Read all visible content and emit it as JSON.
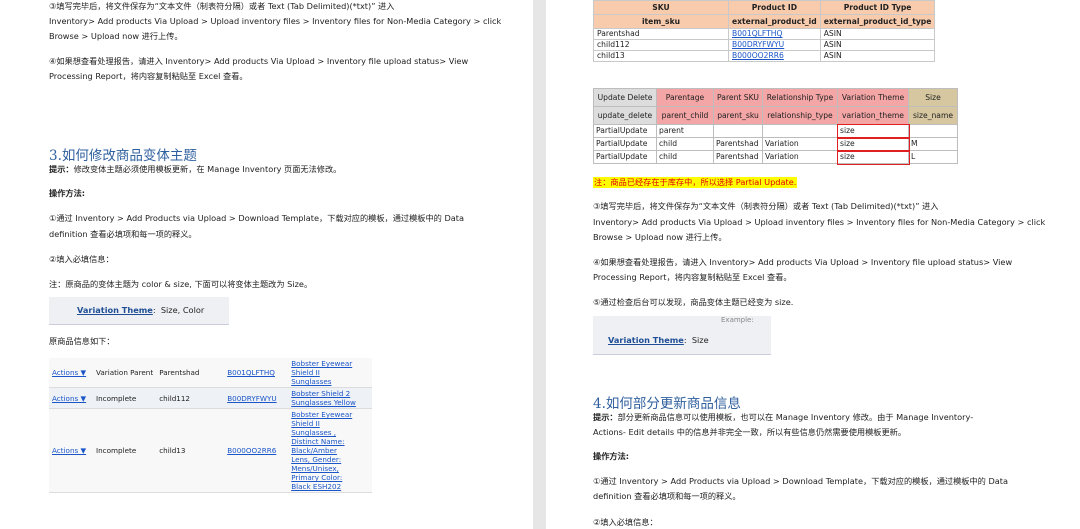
{
  "left": {
    "p3a": "③填写完毕后，将文件保存为“文本文件（制表符分隔）或者 Text (Tab Delimited)(*txt)” 进入",
    "p3b": "Inventory> Add products Via Upload > Upload inventory files > Inventory files for Non-Media Category > click",
    "p3c": "Browse > Upload now 进行上传。",
    "p4a": "④如果想查看处理报告，请进入 Inventory> Add products Via Upload > Inventory file upload status> View",
    "p4b": "Processing Report，将内容复制粘贴至 Excel 查看。",
    "heading": "3.如何修改商品变体主题",
    "tip_label": "提示：",
    "tip": "修改变体主题必须使用模板更新，在 Manage Inventory 页面无法修改。",
    "method": "操作方法:",
    "s1a": "①通过 Inventory > Add Products via Upload > Download Template，下载对应的模板，通过模板中的 Data",
    "s1b": "definition 查看必填项和每一项的释义。",
    "s2": "②填入必填信息：",
    "note": "注：原商品的变体主题为 color & size, 下面可以将变体主题改为 Size。",
    "vt_label": "Variation Theme",
    "vt_value": "Size, Color",
    "orig": "原商品信息如下：",
    "inv_rows": [
      {
        "action": "Actions ▼",
        "status": "Variation Parent",
        "sku": "Parentshad",
        "asin": "B001QLFTHQ",
        "title": [
          "Bobster Eyewear",
          "Shield II",
          "Sunglasses"
        ]
      },
      {
        "action": "Actions ▼",
        "status": "Incomplete",
        "sku": "child112",
        "asin": "B00DRYFWYU",
        "title": [
          "Bobster Shield 2",
          "Sunglasses Yellow"
        ]
      },
      {
        "action": "Actions ▼",
        "status": "Incomplete",
        "sku": "child13",
        "asin": "B000OO2RR6",
        "title": [
          "Bobster Eyewear",
          "Shield II",
          "Sunglasses ,",
          "Distinct Name:",
          "Black/Amber",
          "Lens, Gender:",
          "Mens/Unisex,",
          "Primary Color:",
          "Black ESH202"
        ]
      }
    ]
  },
  "right": {
    "t1_head1": [
      "SKU",
      "Product ID",
      "Product ID Type"
    ],
    "t1_head2": [
      "item_sku",
      "external_product_id",
      "external_product_id_type"
    ],
    "t1_rows": [
      [
        "Parentshad",
        "B001QLFTHQ",
        "ASIN"
      ],
      [
        "child112",
        "B00DRYFWYU",
        "ASIN"
      ],
      [
        "child13",
        "B000OO2RR6",
        "ASIN"
      ]
    ],
    "t2_head1": [
      "Update Delete",
      "Parentage",
      "Parent SKU",
      "Relationship Type",
      "Variation Theme",
      "Size"
    ],
    "t2_head2": [
      "update_delete",
      "parent_child",
      "parent_sku",
      "relationship_type",
      "variation_theme",
      "size_name"
    ],
    "t2_rows": [
      [
        "PartialUpdate",
        "parent",
        "",
        "",
        "size",
        ""
      ],
      [
        "PartialUpdate",
        "child",
        "Parentshad",
        "Variation",
        "size",
        "M"
      ],
      [
        "PartialUpdate",
        "child",
        "Parentshad",
        "Variation",
        "size",
        "L"
      ]
    ],
    "note": "注：商品已经存在于库存中，所以选择 Partial Update.",
    "p3a": "③填写完毕后，将文件保存为“文本文件（制表符分隔）或者 Text (Tab Delimited)(*txt)” 进入",
    "p3b": "Inventory> Add products Via Upload > Upload inventory files > Inventory files for Non-Media Category > click",
    "p3c": "Browse > Upload now 进行上传。",
    "p4a": "④如果想查看处理报告，请进入 Inventory> Add products Via Upload > Inventory file upload status> View",
    "p4b": "Processing Report，将内容复制粘贴至 Excel 查看。",
    "p5": "⑤通过检查后台可以发现，商品变体主题已经变为 size.",
    "example": "Example:",
    "vt_label": "Variation Theme",
    "vt_value": "Size",
    "heading": "4.如何部分更新商品信息",
    "tip_label": "提示：",
    "tip_a": "部分更新商品信息可以使用模板，也可以在 Manage Inventory 修改。由于 Manage Inventory-",
    "tip_b": "Actions- Edit details 中的信息并非完全一致，所以有些信息仍然需要使用模板更新。",
    "method": "操作方法:",
    "s1a": "①通过 Inventory > Add Products via Upload > Download Template，下载对应的模板，通过模板中的 Data",
    "s1b": "definition 查看必填项和每一项的释义。",
    "s2": "②填入必填信息："
  }
}
